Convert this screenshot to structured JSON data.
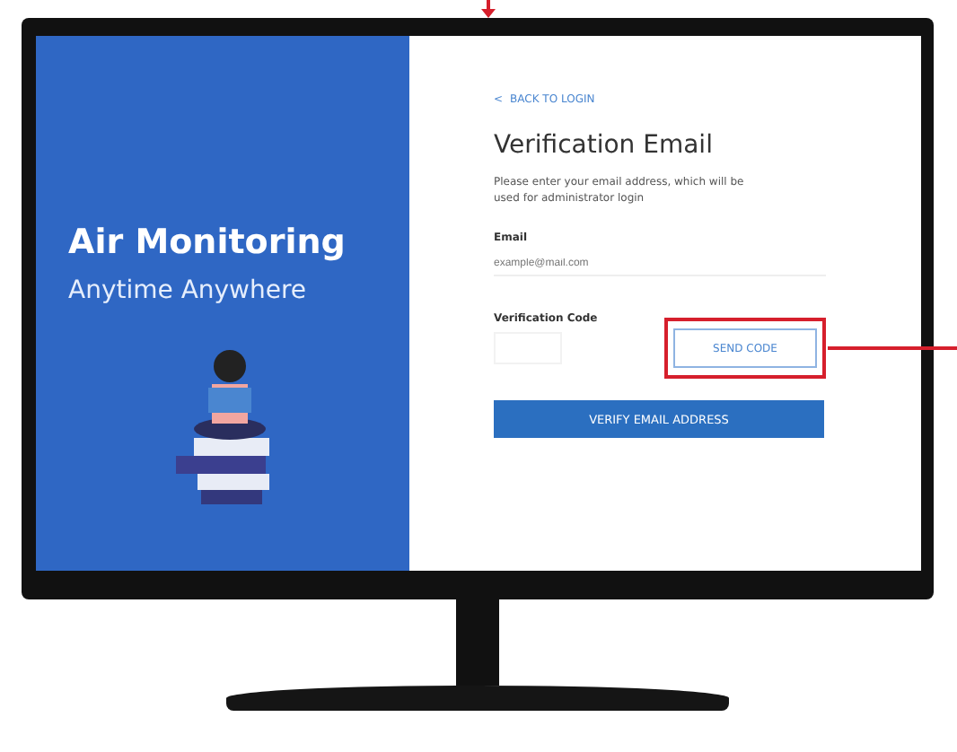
{
  "hero": {
    "title": "Air Monitoring",
    "subtitle": "Anytime Anywhere"
  },
  "back_link": {
    "icon": "<",
    "label": "BACK TO LOGIN"
  },
  "heading": "Verification Email",
  "description": "Please enter your email address, which will be used for administrator login",
  "fields": [
    {
      "kind": "email",
      "label": "Email",
      "placeholder": "example@mail.com"
    },
    {
      "kind": "code",
      "label": "Verification Code",
      "button": "SEND CODE",
      "highlighted": true
    }
  ],
  "submit": "VERIFY EMAIL ADDRESS"
}
